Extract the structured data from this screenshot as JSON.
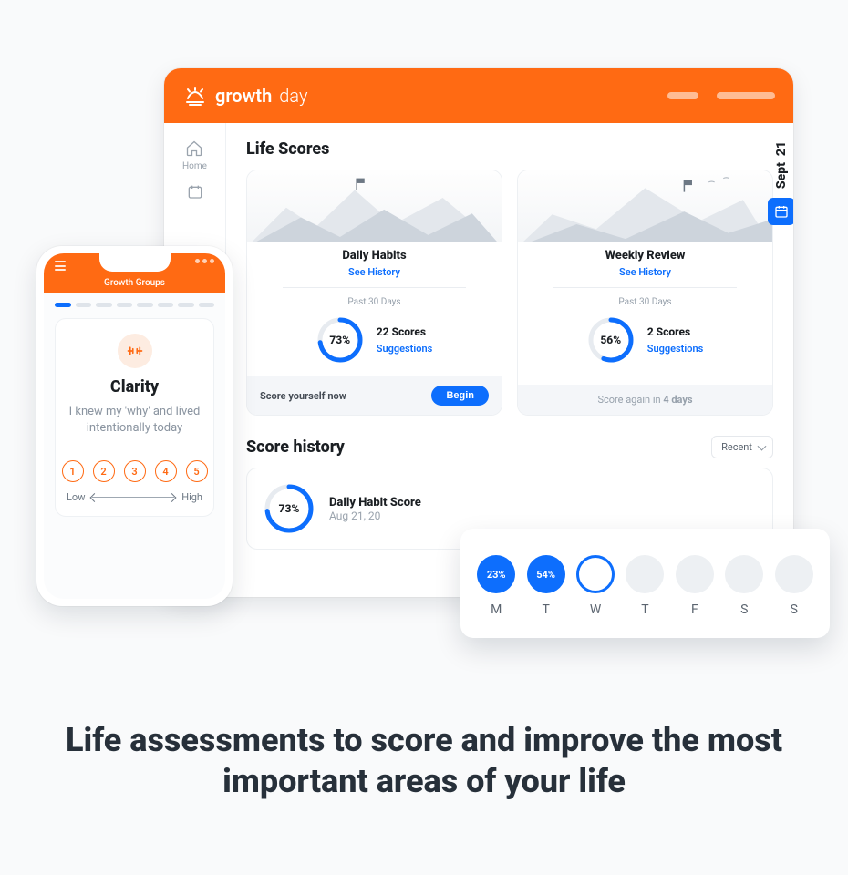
{
  "brand": {
    "name1": "growth",
    "name2": "day"
  },
  "nav": {
    "home": "Home"
  },
  "life": {
    "heading": "Life Scores",
    "date_day": "21",
    "date_month": "Sept",
    "daily": {
      "title": "Daily Habits",
      "link": "See History",
      "period": "Past 30 Days",
      "pct": "73%",
      "pct_num": 73,
      "count": "22 Scores",
      "suggest": "Suggestions",
      "foot_txt": "Score yourself now",
      "begin": "Begin"
    },
    "weekly": {
      "title": "Weekly Review",
      "link": "See History",
      "period": "Past 30 Days",
      "pct": "56%",
      "pct_num": 56,
      "count": "2 Scores",
      "suggest": "Suggestions",
      "foot_pre": "Score again in ",
      "foot_b": "4 days"
    }
  },
  "history": {
    "heading": "Score history",
    "recent": "Recent",
    "pct": "73%",
    "pct_num": 73,
    "title": "Daily Habit Score",
    "date": "Aug 21, 20"
  },
  "week": {
    "days": [
      "M",
      "T",
      "W",
      "T",
      "F",
      "S",
      "S"
    ],
    "d0_pct": "23%",
    "d1_pct": "54%"
  },
  "phone": {
    "header": "Growth Groups",
    "title": "Clarity",
    "body": "I knew my 'why' and lived intentionally today",
    "low": "Low",
    "high": "High",
    "scores": [
      "1",
      "2",
      "3",
      "4",
      "5"
    ]
  },
  "headline": "Life assessments to score and improve the most important areas of your life"
}
